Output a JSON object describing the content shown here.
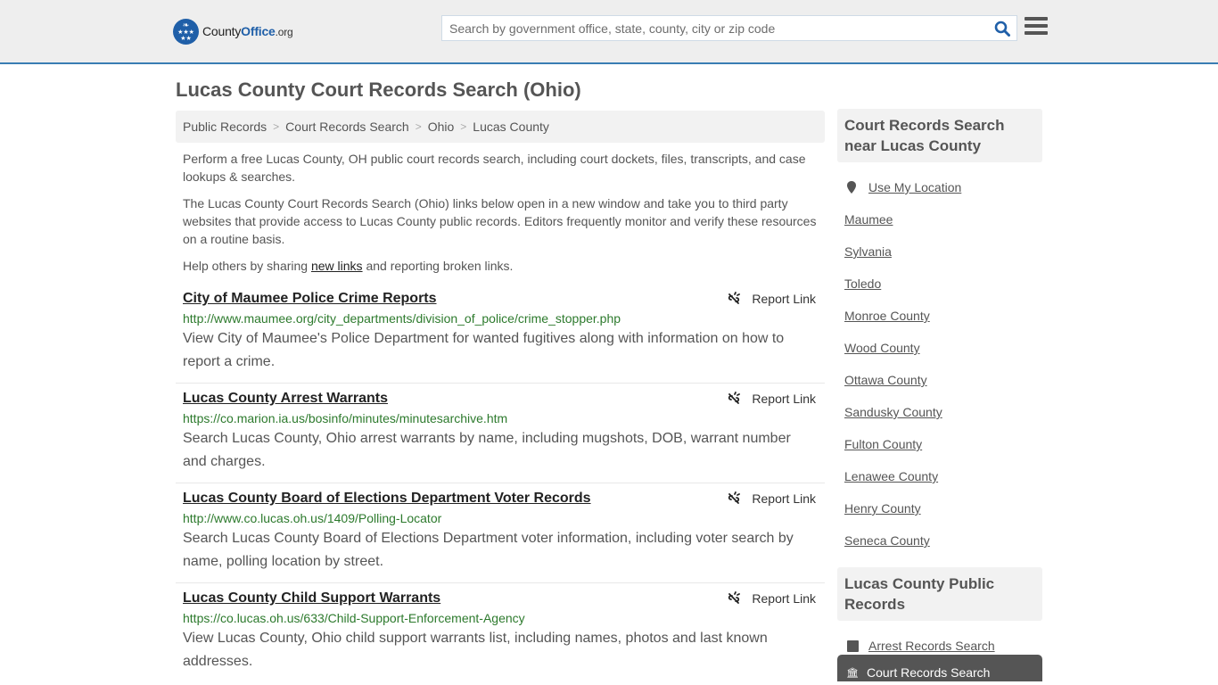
{
  "header": {
    "logo": {
      "name": "County",
      "brand": "Office",
      "tld": ".org"
    },
    "search": {
      "placeholder": "Search by government office, state, county, city or zip code",
      "value": ""
    },
    "colors": {
      "accent": "#3a7db3",
      "brand": "#1f5fa8",
      "header_bg": "#eeeeee"
    }
  },
  "page": {
    "title": "Lucas County Court Records Search (Ohio)"
  },
  "breadcrumb": [
    {
      "label": "Public Records"
    },
    {
      "label": "Court Records Search"
    },
    {
      "label": "Ohio"
    },
    {
      "label": "Lucas County"
    }
  ],
  "intro": {
    "p1": "Perform a free Lucas County, OH public court records search, including court dockets, files, transcripts, and case lookups & searches.",
    "p2": "The Lucas County Court Records Search (Ohio) links below open in a new window and take you to third party websites that provide access to Lucas County public records. Editors frequently monitor and verify these resources on a routine basis.",
    "p3_before": "Help others by sharing ",
    "p3_link": "new links",
    "p3_after": " and reporting broken links."
  },
  "links": [
    {
      "title": "City of Maumee Police Crime Reports",
      "url": "http://www.maumee.org/city_departments/division_of_police/crime_stopper.php",
      "description": "View City of Maumee's Police Department for wanted fugitives along with information on how to report a crime.",
      "report_label": "Report Link"
    },
    {
      "title": "Lucas County Arrest Warrants",
      "url": "https://co.marion.ia.us/bosinfo/minutes/minutesarchive.htm",
      "description": "Search Lucas County, Ohio arrest warrants by name, including mugshots, DOB, warrant number and charges.",
      "report_label": "Report Link"
    },
    {
      "title": "Lucas County Board of Elections Department Voter Records",
      "url": "http://www.co.lucas.oh.us/1409/Polling-Locator",
      "description": "Search Lucas County Board of Elections Department voter information, including voter search by name, polling location by street.",
      "report_label": "Report Link"
    },
    {
      "title": "Lucas County Child Support Warrants",
      "url": "https://co.lucas.oh.us/633/Child-Support-Enforcement-Agency",
      "description": "View Lucas County, Ohio child support warrants list, including names, photos and last known addresses.",
      "report_label": "Report Link"
    }
  ],
  "sidebar": {
    "nearby": {
      "heading": "Court Records Search near Lucas County",
      "use_location": "Use My Location",
      "items": [
        "Maumee",
        "Sylvania",
        "Toledo",
        "Monroe County",
        "Wood County",
        "Ottawa County",
        "Sandusky County",
        "Fulton County",
        "Lenawee County",
        "Henry County",
        "Seneca County"
      ]
    },
    "public_records": {
      "heading": "Lucas County Public Records",
      "items": [
        {
          "label": "Arrest Records Search",
          "icon": "square-icon",
          "active": false
        },
        {
          "label": "Court Records Search",
          "icon": "bank-icon",
          "active": true
        }
      ]
    }
  }
}
